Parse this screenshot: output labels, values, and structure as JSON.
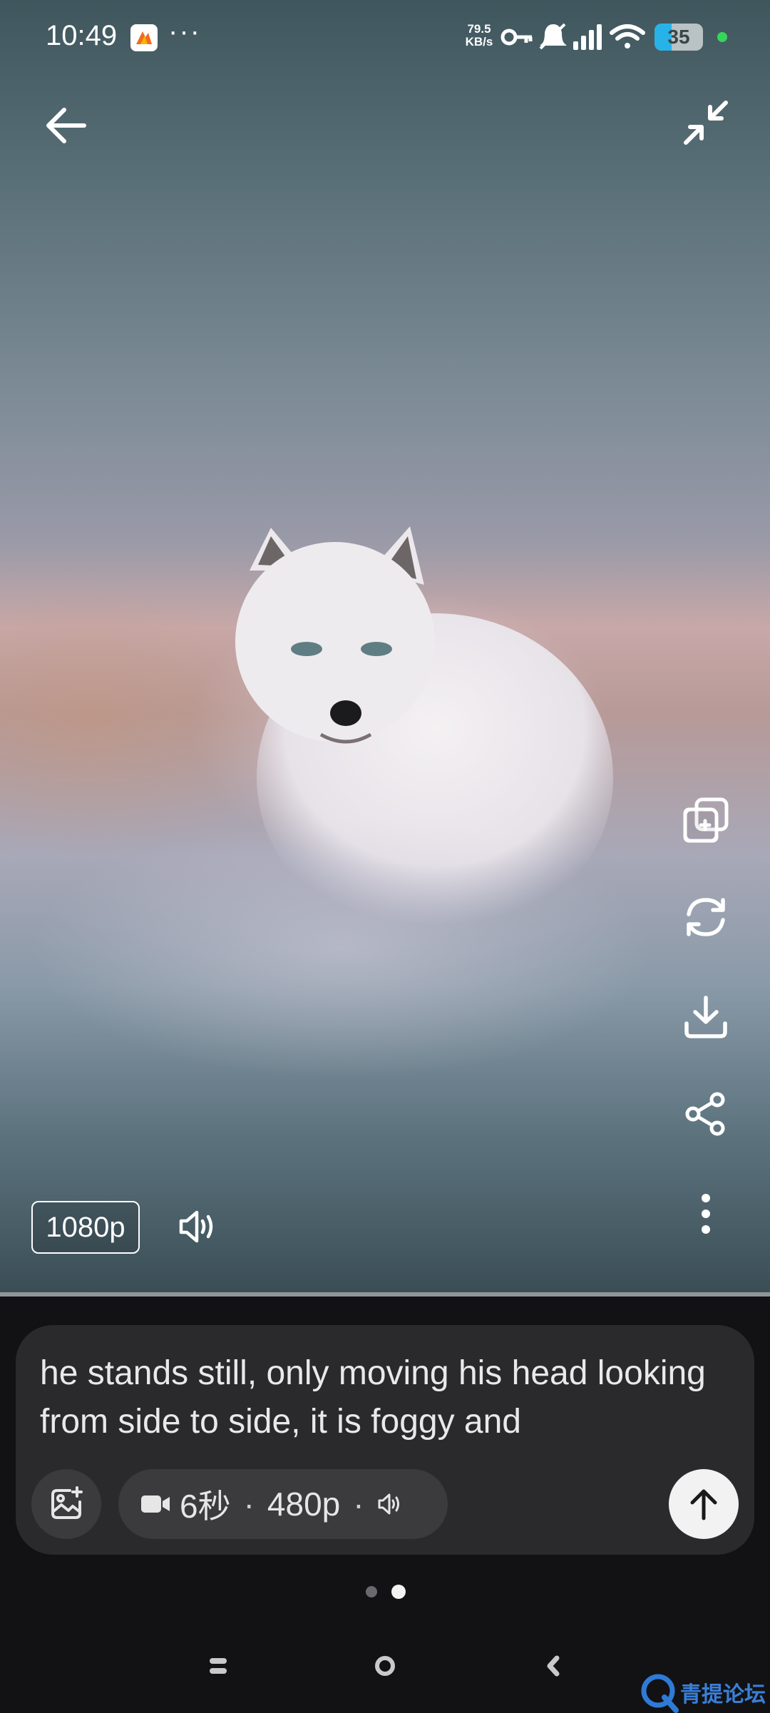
{
  "status_bar": {
    "time": "10:49",
    "more": "···",
    "net_speed_value": "79.5",
    "net_speed_unit": "KB/s",
    "battery": "35",
    "icons": [
      "app-notification-icon",
      "key-icon",
      "bell-muted-icon",
      "signal-icon",
      "wifi-icon",
      "battery-icon"
    ]
  },
  "player": {
    "back_icon": "arrow-left-icon",
    "exit_fullscreen_icon": "collapse-icon",
    "quality": "1080p",
    "volume_icon": "speaker-icon",
    "side_actions": [
      "add-copy-icon",
      "regenerate-icon",
      "download-icon",
      "share-icon",
      "more-vertical-icon"
    ]
  },
  "composer": {
    "prompt": "he stands still, only moving his head looking from side to side, it is foggy and",
    "duration": "6秒",
    "resolution": "480p",
    "separator": "·",
    "image_button_icon": "image-add-icon",
    "send_icon": "arrow-up-icon"
  },
  "pagination": {
    "total": 2,
    "active": 2
  },
  "watermark": {
    "text": "青提论坛"
  },
  "colors": {
    "accent_blue": "#27b3e8",
    "watermark_blue": "#3a7fd8",
    "composer_bg": "#2a2a2c"
  }
}
